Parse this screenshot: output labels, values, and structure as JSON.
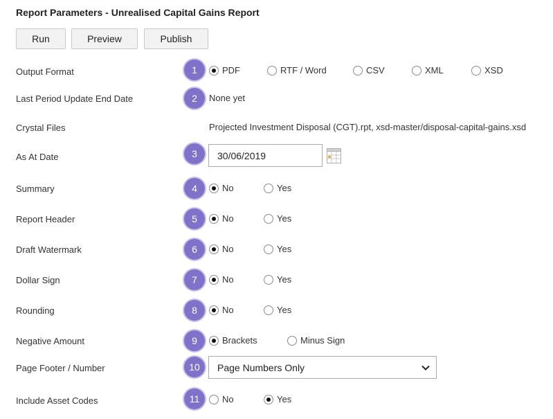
{
  "title": "Report Parameters - Unrealised Capital Gains Report",
  "buttons": {
    "run": "Run",
    "preview": "Preview",
    "publish": "Publish"
  },
  "fields": {
    "output_format": {
      "label": "Output Format",
      "badge": "1",
      "options": [
        "PDF",
        "RTF / Word",
        "CSV",
        "XML",
        "XSD"
      ],
      "selected": "PDF"
    },
    "last_period": {
      "label": "Last Period Update End Date",
      "badge": "2",
      "value": "None yet"
    },
    "crystal_files": {
      "label": "Crystal Files",
      "value": "Projected Investment Disposal (CGT).rpt, xsd-master/disposal-capital-gains.xsd"
    },
    "as_at_date": {
      "label": "As At Date",
      "badge": "3",
      "value": "30/06/2019"
    },
    "summary": {
      "label": "Summary",
      "badge": "4",
      "options": [
        "No",
        "Yes"
      ],
      "selected": "No"
    },
    "report_header": {
      "label": "Report Header",
      "badge": "5",
      "options": [
        "No",
        "Yes"
      ],
      "selected": "No"
    },
    "draft_watermark": {
      "label": "Draft Watermark",
      "badge": "6",
      "options": [
        "No",
        "Yes"
      ],
      "selected": "No"
    },
    "dollar_sign": {
      "label": "Dollar Sign",
      "badge": "7",
      "options": [
        "No",
        "Yes"
      ],
      "selected": "No"
    },
    "rounding": {
      "label": "Rounding",
      "badge": "8",
      "options": [
        "No",
        "Yes"
      ],
      "selected": "No"
    },
    "negative_amount": {
      "label": "Negative Amount",
      "badge": "9",
      "options": [
        "Brackets",
        "Minus Sign"
      ],
      "selected": "Brackets"
    },
    "page_footer": {
      "label": "Page Footer / Number",
      "badge": "10",
      "value": "Page Numbers Only"
    },
    "include_asset_codes": {
      "label": "Include Asset Codes",
      "badge": "11",
      "options": [
        "No",
        "Yes"
      ],
      "selected": "Yes"
    }
  },
  "colors": {
    "badge": "#7f72c8",
    "button_bg": "#f2f2f2",
    "border": "#a9a9a9"
  },
  "icons": {
    "calendar": "calendar-icon",
    "dropdown": "chevron-down-icon"
  }
}
